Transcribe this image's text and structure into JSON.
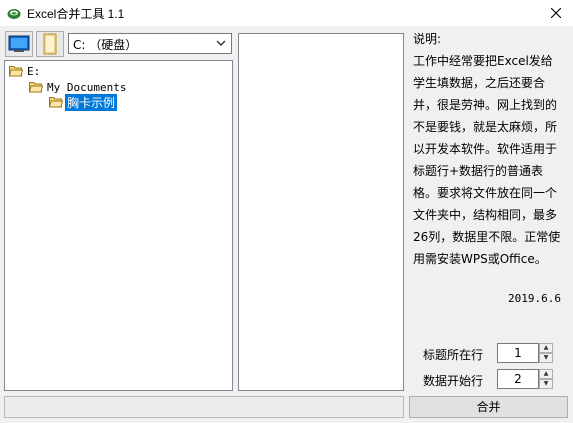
{
  "window": {
    "title": "Excel合并工具 1.1"
  },
  "toolbar": {
    "drive_value": "C: （硬盘）"
  },
  "tree": {
    "nodes": [
      {
        "label": "E:"
      },
      {
        "label": "My Documents"
      },
      {
        "label": "胸卡示例"
      }
    ]
  },
  "description": {
    "heading": "说明:",
    "body": "工作中经常要把Excel发给学生填数据，之后还要合并，很是劳神。网上找到的不是要钱，就是太麻烦，所以开发本软件。软件适用于标题行+数据行的普通表格。要求将文件放在同一个文件夹中，结构相同，最多26列，数据里不限。正常使用需安装WPS或Office。",
    "date": "2019.6.6"
  },
  "settings": {
    "title_row_label": "标题所在行",
    "title_row_value": "1",
    "data_start_label": "数据开始行",
    "data_start_value": "2"
  },
  "actions": {
    "merge_label": "合并"
  }
}
